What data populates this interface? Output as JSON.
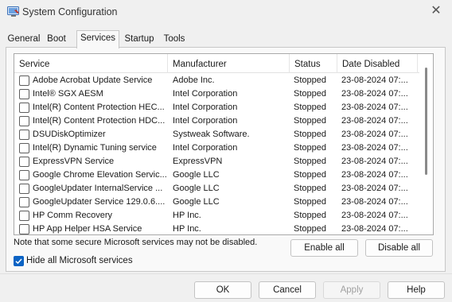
{
  "window": {
    "title": "System Configuration",
    "close_glyph": "✕",
    "icon": "system-configuration-icon"
  },
  "tabs": [
    {
      "label": "General"
    },
    {
      "label": "Boot"
    },
    {
      "label": "Services",
      "active": true
    },
    {
      "label": "Startup"
    },
    {
      "label": "Tools"
    }
  ],
  "services_table": {
    "columns": [
      "Service",
      "Manufacturer",
      "Status",
      "Date Disabled"
    ],
    "rows": [
      {
        "service": "Adobe Acrobat Update Service",
        "manufacturer": "Adobe Inc.",
        "status": "Stopped",
        "date": "23-08-2024 07:..."
      },
      {
        "service": "Intel® SGX AESM",
        "manufacturer": "Intel Corporation",
        "status": "Stopped",
        "date": "23-08-2024 07:..."
      },
      {
        "service": "Intel(R) Content Protection HEC...",
        "manufacturer": "Intel Corporation",
        "status": "Stopped",
        "date": "23-08-2024 07:..."
      },
      {
        "service": "Intel(R) Content Protection HDC...",
        "manufacturer": "Intel Corporation",
        "status": "Stopped",
        "date": "23-08-2024 07:..."
      },
      {
        "service": "DSUDiskOptimizer",
        "manufacturer": "Systweak Software.",
        "status": "Stopped",
        "date": "23-08-2024 07:..."
      },
      {
        "service": "Intel(R) Dynamic Tuning service",
        "manufacturer": "Intel Corporation",
        "status": "Stopped",
        "date": "23-08-2024 07:..."
      },
      {
        "service": "ExpressVPN Service",
        "manufacturer": "ExpressVPN",
        "status": "Stopped",
        "date": "23-08-2024 07:..."
      },
      {
        "service": "Google Chrome Elevation Servic...",
        "manufacturer": "Google LLC",
        "status": "Stopped",
        "date": "23-08-2024 07:..."
      },
      {
        "service": "GoogleUpdater InternalService ...",
        "manufacturer": "Google LLC",
        "status": "Stopped",
        "date": "23-08-2024 07:..."
      },
      {
        "service": "GoogleUpdater Service 129.0.6....",
        "manufacturer": "Google LLC",
        "status": "Stopped",
        "date": "23-08-2024 07:..."
      },
      {
        "service": "HP Comm Recovery",
        "manufacturer": "HP Inc.",
        "status": "Stopped",
        "date": "23-08-2024 07:..."
      },
      {
        "service": "HP App Helper HSA Service",
        "manufacturer": "HP Inc.",
        "status": "Stopped",
        "date": "23-08-2024 07:..."
      }
    ]
  },
  "note": "Note that some secure Microsoft services may not be disabled.",
  "enable_all_label": "Enable all",
  "disable_all_label": "Disable all",
  "hide_ms_label": "Hide all Microsoft services",
  "hide_ms_checked": true,
  "footer": {
    "ok_label": "OK",
    "cancel_label": "Cancel",
    "apply_label": "Apply",
    "help_label": "Help"
  },
  "colors": {
    "accent": "#0b63c4",
    "window_bg": "#f0f0f0"
  }
}
